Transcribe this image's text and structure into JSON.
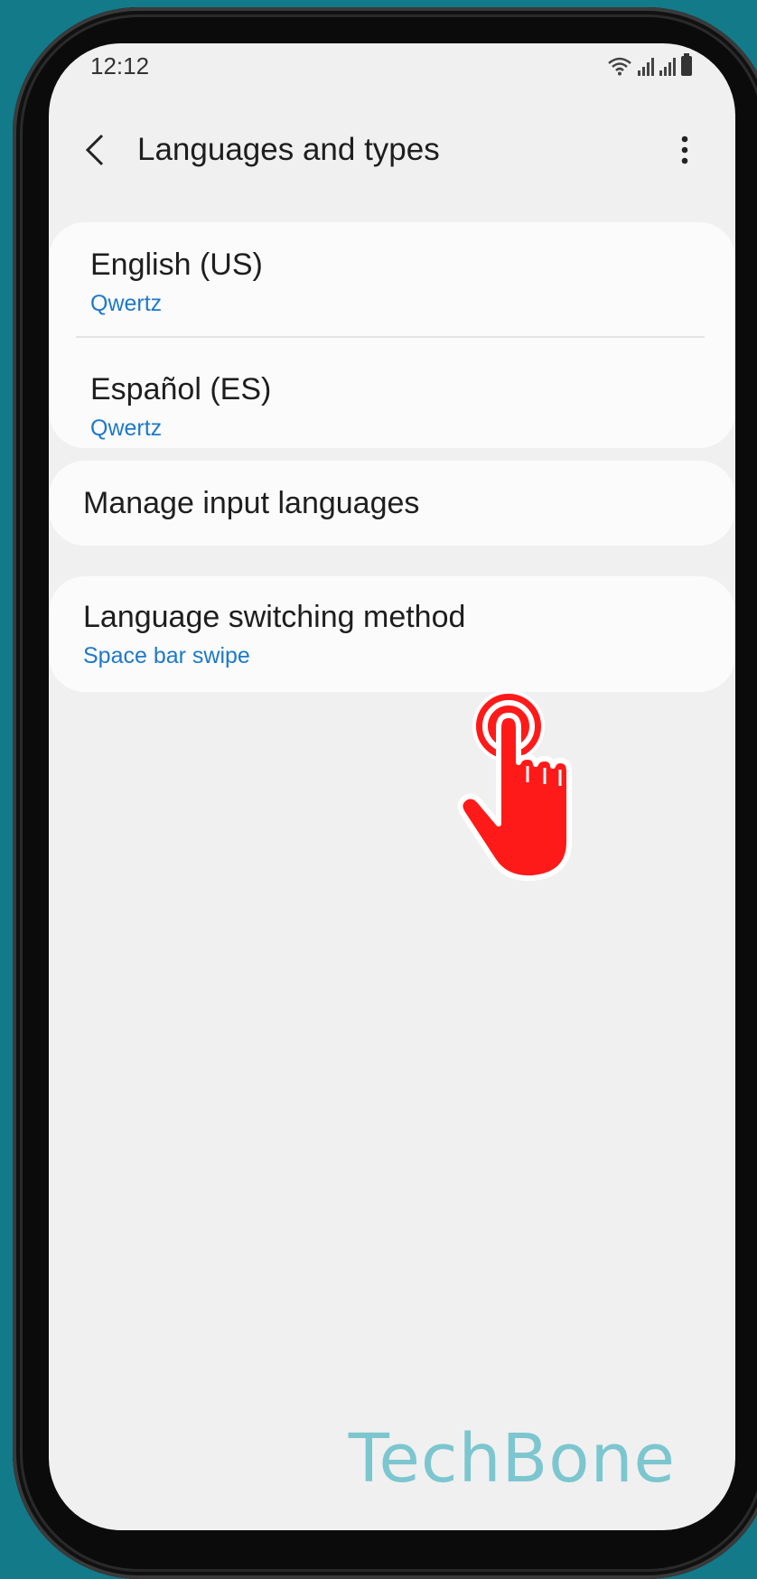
{
  "status_bar": {
    "time": "12:12"
  },
  "app_bar": {
    "title": "Languages and types",
    "back_icon": "chevron-left-icon",
    "more_icon": "more-vertical-icon"
  },
  "languages": [
    {
      "title": "English (US)",
      "subtitle": "Qwertz"
    },
    {
      "title": "Español (ES)",
      "subtitle": "Qwertz"
    }
  ],
  "manage": {
    "title": "Manage input languages"
  },
  "switching": {
    "title": "Language switching method",
    "subtitle": "Space bar swipe"
  },
  "watermark": "TechBone",
  "colors": {
    "background": "#137a8a",
    "accent": "#1e79c8",
    "hand": "#ff1a1a"
  }
}
